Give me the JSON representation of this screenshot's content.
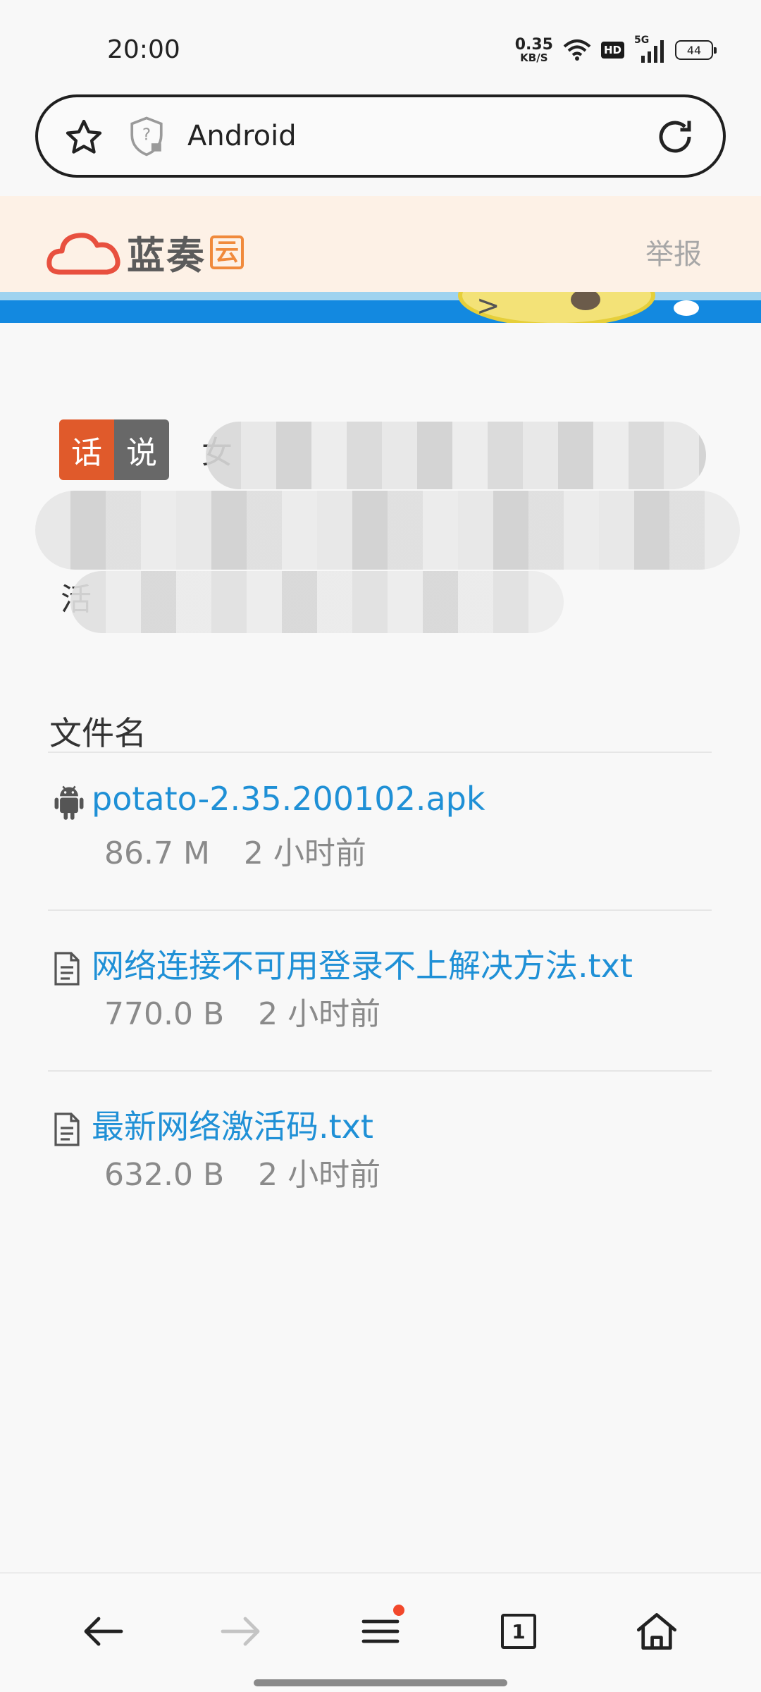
{
  "status_bar": {
    "time": "20:00",
    "net_speed_value": "0.35",
    "net_speed_unit": "KB/S",
    "hd": "HD",
    "signal": "5G",
    "battery": "44"
  },
  "browser": {
    "url_text": "Android"
  },
  "site": {
    "logo_text": "蓝奏",
    "logo_badge": "云",
    "report": "举报",
    "brand_color": "#f08a3c"
  },
  "notice": {
    "tag_left": "话",
    "tag_right": "说",
    "char_line1": "女",
    "char_line3": "活"
  },
  "file_list": {
    "header": "文件名",
    "files": [
      {
        "icon": "android-icon",
        "name": "potato-2.35.200102.apk",
        "size": "86.7 M",
        "time": "2 小时前"
      },
      {
        "icon": "document-icon",
        "name": "网络连接不可用登录不上解决方法.txt",
        "size": "770.0 B",
        "time": "2 小时前"
      },
      {
        "icon": "document-icon",
        "name": "最新网络激活码.txt",
        "size": "632.0 B",
        "time": "2 小时前"
      }
    ]
  },
  "bottom_nav": {
    "tabs_count": "1",
    "icons": [
      "back-arrow-icon",
      "forward-arrow-icon",
      "menu-icon",
      "tabs-icon",
      "home-icon"
    ]
  },
  "colors": {
    "link": "#1f90d6",
    "tag_orange": "#e05a2b",
    "tag_gray": "#686868",
    "menu_badge": "#f2482b"
  }
}
